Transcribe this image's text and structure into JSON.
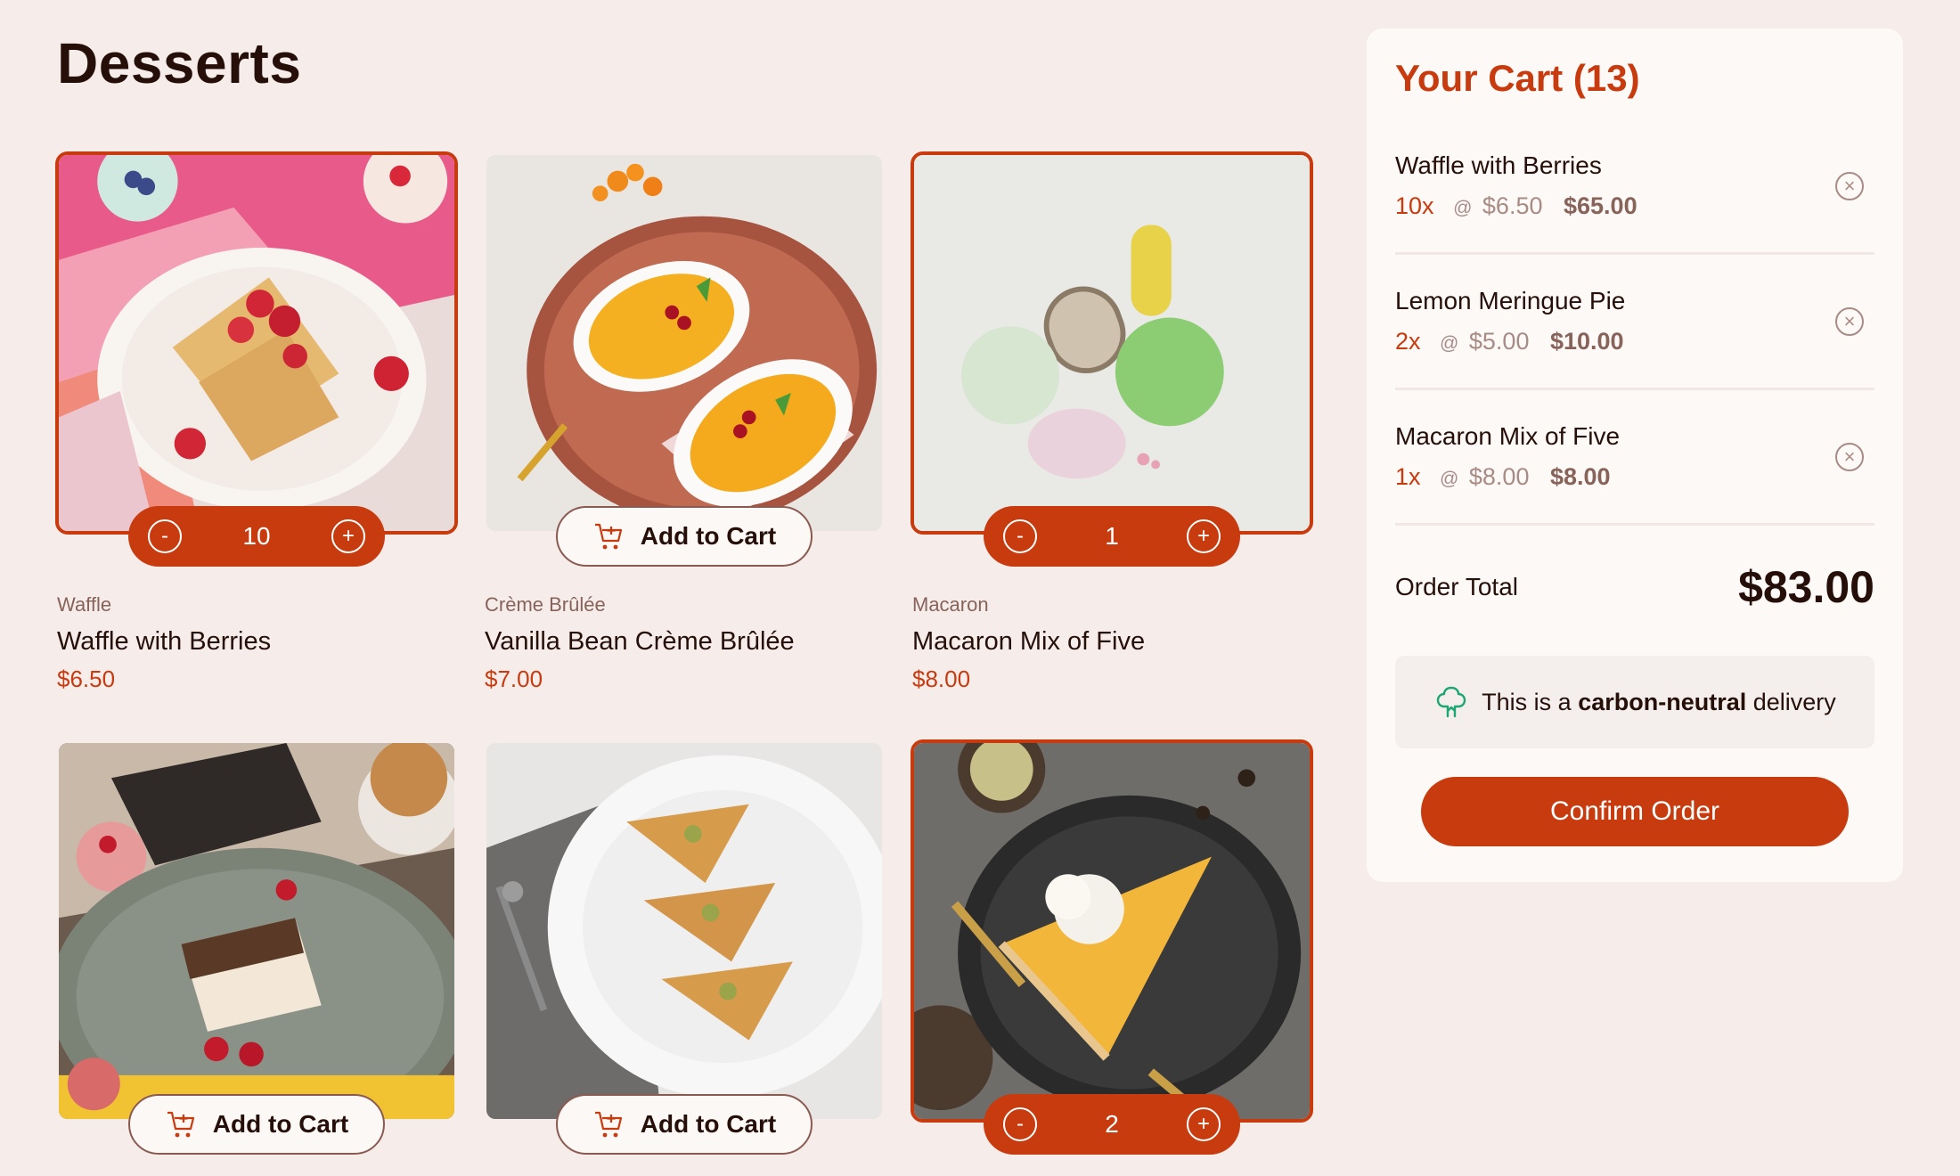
{
  "page": {
    "title": "Desserts"
  },
  "products": [
    {
      "category": "Waffle",
      "name": "Waffle with Berries",
      "price": "$6.50",
      "qty": "10",
      "in_cart": true
    },
    {
      "category": "Crème Brûlée",
      "name": "Vanilla Bean Crème Brûlée",
      "price": "$7.00",
      "in_cart": false
    },
    {
      "category": "Macaron",
      "name": "Macaron Mix of Five",
      "price": "$8.00",
      "qty": "1",
      "in_cart": true
    },
    {
      "category": "",
      "name": "",
      "price": "",
      "in_cart": false
    },
    {
      "category": "",
      "name": "",
      "price": "",
      "in_cart": false
    },
    {
      "category": "",
      "name": "",
      "price": "",
      "qty": "2",
      "in_cart": true
    }
  ],
  "buttons": {
    "add_to_cart": "Add to Cart",
    "decrement": "-",
    "increment": "+"
  },
  "cart": {
    "title": "Your Cart (13)",
    "items": [
      {
        "name": "Waffle with Berries",
        "qty": "10x",
        "at": "@",
        "unit": "$6.50",
        "total": "$65.00"
      },
      {
        "name": "Lemon Meringue Pie",
        "qty": "2x",
        "at": "@",
        "unit": "$5.00",
        "total": "$10.00"
      },
      {
        "name": "Macaron Mix of Five",
        "qty": "1x",
        "at": "@",
        "unit": "$8.00",
        "total": "$8.00"
      }
    ],
    "order_total_label": "Order Total",
    "order_total_value": "$83.00",
    "carbon_prefix": "This is a",
    "carbon_bold": "carbon-neutral",
    "carbon_suffix": "delivery",
    "confirm_label": "Confirm Order"
  },
  "colors": {
    "accent": "#c73b0f",
    "background": "#f6edeb",
    "text": "#260f08",
    "muted": "#87635a",
    "green": "#1ea575"
  },
  "icons": {
    "cart": "add-to-cart-icon",
    "remove": "remove-item-icon",
    "carbon": "carbon-neutral-tree-icon"
  }
}
